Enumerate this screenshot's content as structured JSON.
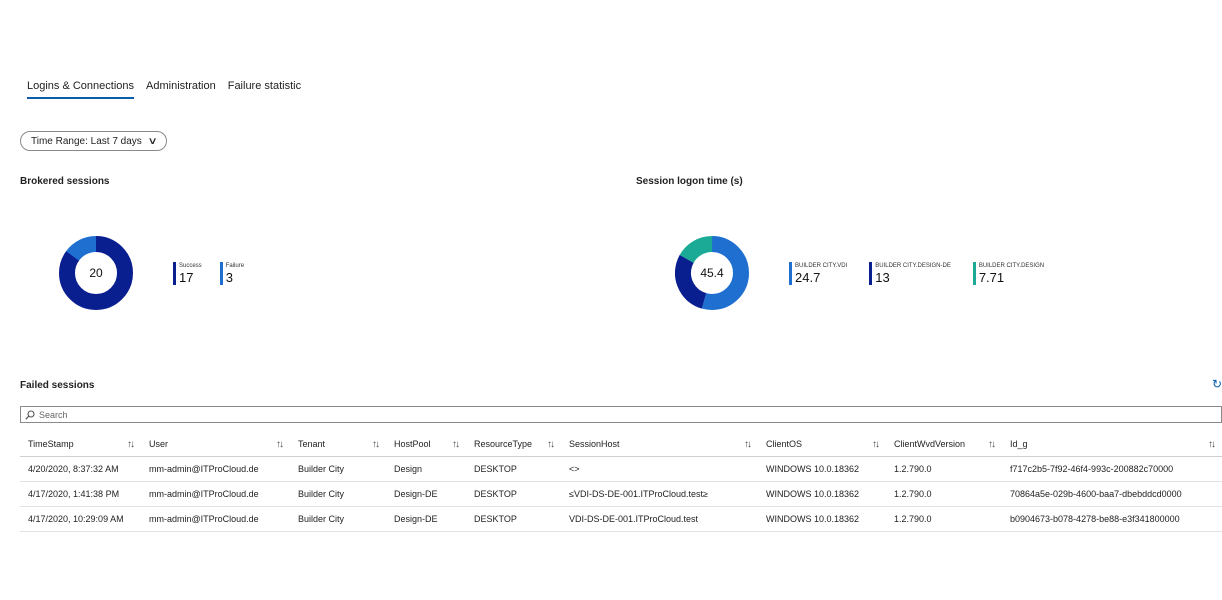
{
  "tabs": [
    {
      "label": "Logins & Connections"
    },
    {
      "label": "Administration"
    },
    {
      "label": "Failure statistic"
    }
  ],
  "time_range": {
    "label": "Time Range: Last 7 days"
  },
  "brokered": {
    "title": "Brokered sessions",
    "total": "20",
    "legend": [
      {
        "name": "Success",
        "value": "17",
        "color": "#0a1f8f"
      },
      {
        "name": "Failure",
        "value": "3",
        "color": "#1e6fd0"
      }
    ]
  },
  "logon": {
    "title": "Session logon time (s)",
    "total": "45.4",
    "legend": [
      {
        "name": "BUILDER CITY.VDI",
        "value": "24.7",
        "color": "#1e6fd0"
      },
      {
        "name": "BUILDER CITY.DESIGN-DE",
        "value": "13",
        "color": "#0a1f8f"
      },
      {
        "name": "BUILDER CITY.DESIGN",
        "value": "7.71",
        "color": "#1aaa96"
      }
    ]
  },
  "failed": {
    "title": "Failed sessions",
    "search_placeholder": "Search",
    "columns": [
      "TimeStamp",
      "User",
      "Tenant",
      "HostPool",
      "ResourceType",
      "SessionHost",
      "ClientOS",
      "ClientWvdVersion",
      "Id_g"
    ],
    "rows": [
      [
        "4/20/2020, 8:37:32 AM",
        "mm-admin@ITProCloud.de",
        "Builder City",
        "Design",
        "DESKTOP",
        "<>",
        "WINDOWS 10.0.18362",
        "1.2.790.0",
        "f717c2b5-7f92-46f4-993c-200882c70000"
      ],
      [
        "4/17/2020, 1:41:38 PM",
        "mm-admin@ITProCloud.de",
        "Builder City",
        "Design-DE",
        "DESKTOP",
        "≤VDI-DS-DE-001.ITProCloud.test≥",
        "WINDOWS 10.0.18362",
        "1.2.790.0",
        "70864a5e-029b-4600-baa7-dbebddcd0000"
      ],
      [
        "4/17/2020, 10:29:09 AM",
        "mm-admin@ITProCloud.de",
        "Builder City",
        "Design-DE",
        "DESKTOP",
        "VDI-DS-DE-001.ITProCloud.test",
        "WINDOWS 10.0.18362",
        "1.2.790.0",
        "b0904673-b078-4278-be88-e3f341800000"
      ]
    ]
  }
}
